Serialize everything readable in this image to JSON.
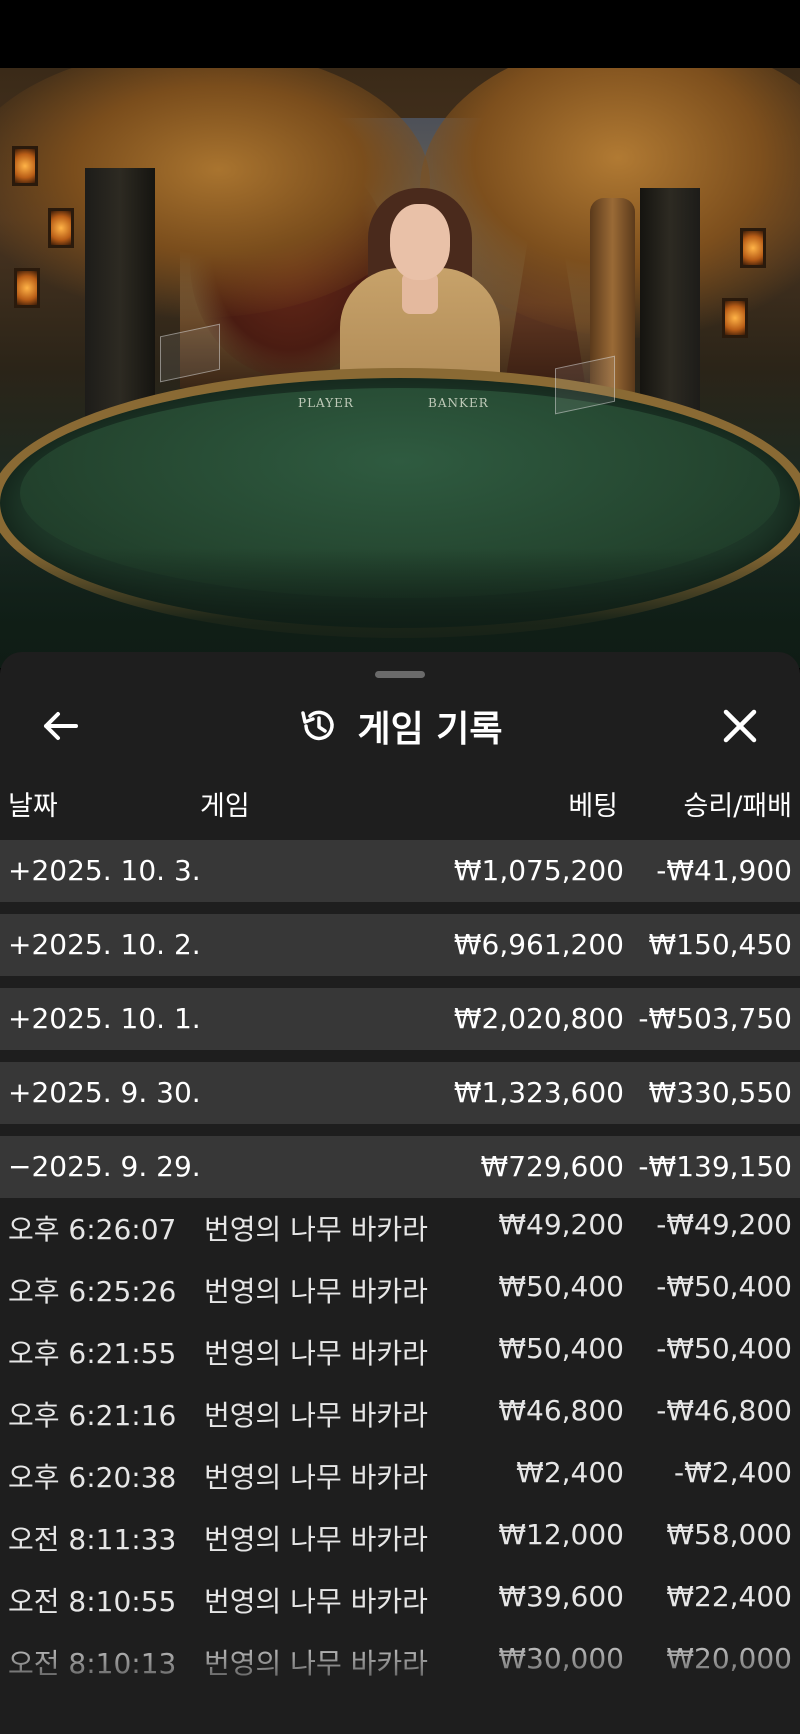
{
  "video": {
    "table_labels": {
      "player": "PLAYER",
      "banker": "BANKER"
    }
  },
  "sheet": {
    "title": "게임 기록",
    "icons": {
      "back": "arrow-left-icon",
      "history": "history-icon",
      "close": "close-icon"
    },
    "columns": {
      "date": "날짜",
      "game": "게임",
      "bet": "베팅",
      "winloss": "승리/패배"
    },
    "days": [
      {
        "date": "+2025. 10. 3.",
        "bet": "₩1,075,200",
        "winloss": "-₩41,900"
      },
      {
        "date": "+2025. 10. 2.",
        "bet": "₩6,961,200",
        "winloss": "₩150,450"
      },
      {
        "date": "+2025. 10. 1.",
        "bet": "₩2,020,800",
        "winloss": "-₩503,750"
      },
      {
        "date": "+2025. 9. 30.",
        "bet": "₩1,323,600",
        "winloss": "₩330,550"
      },
      {
        "date": "−2025. 9. 29.",
        "bet": "₩729,600",
        "winloss": "-₩139,150"
      }
    ],
    "games": [
      {
        "time": "오후 6:26:07",
        "game": "번영의 나무 바카라",
        "bet": "₩49,200",
        "winloss": "-₩49,200"
      },
      {
        "time": "오후 6:25:26",
        "game": "번영의 나무 바카라",
        "bet": "₩50,400",
        "winloss": "-₩50,400"
      },
      {
        "time": "오후 6:21:55",
        "game": "번영의 나무 바카라",
        "bet": "₩50,400",
        "winloss": "-₩50,400"
      },
      {
        "time": "오후 6:21:16",
        "game": "번영의 나무 바카라",
        "bet": "₩46,800",
        "winloss": "-₩46,800"
      },
      {
        "time": "오후 6:20:38",
        "game": "번영의 나무 바카라",
        "bet": "₩2,400",
        "winloss": "-₩2,400"
      },
      {
        "time": "오전 8:11:33",
        "game": "번영의 나무 바카라",
        "bet": "₩12,000",
        "winloss": "₩58,000"
      },
      {
        "time": "오전 8:10:55",
        "game": "번영의 나무 바카라",
        "bet": "₩39,600",
        "winloss": "₩22,400"
      },
      {
        "time": "오전 8:10:13",
        "game": "번영의 나무 바카라",
        "bet": "₩30,000",
        "winloss": "₩20,000"
      }
    ]
  }
}
